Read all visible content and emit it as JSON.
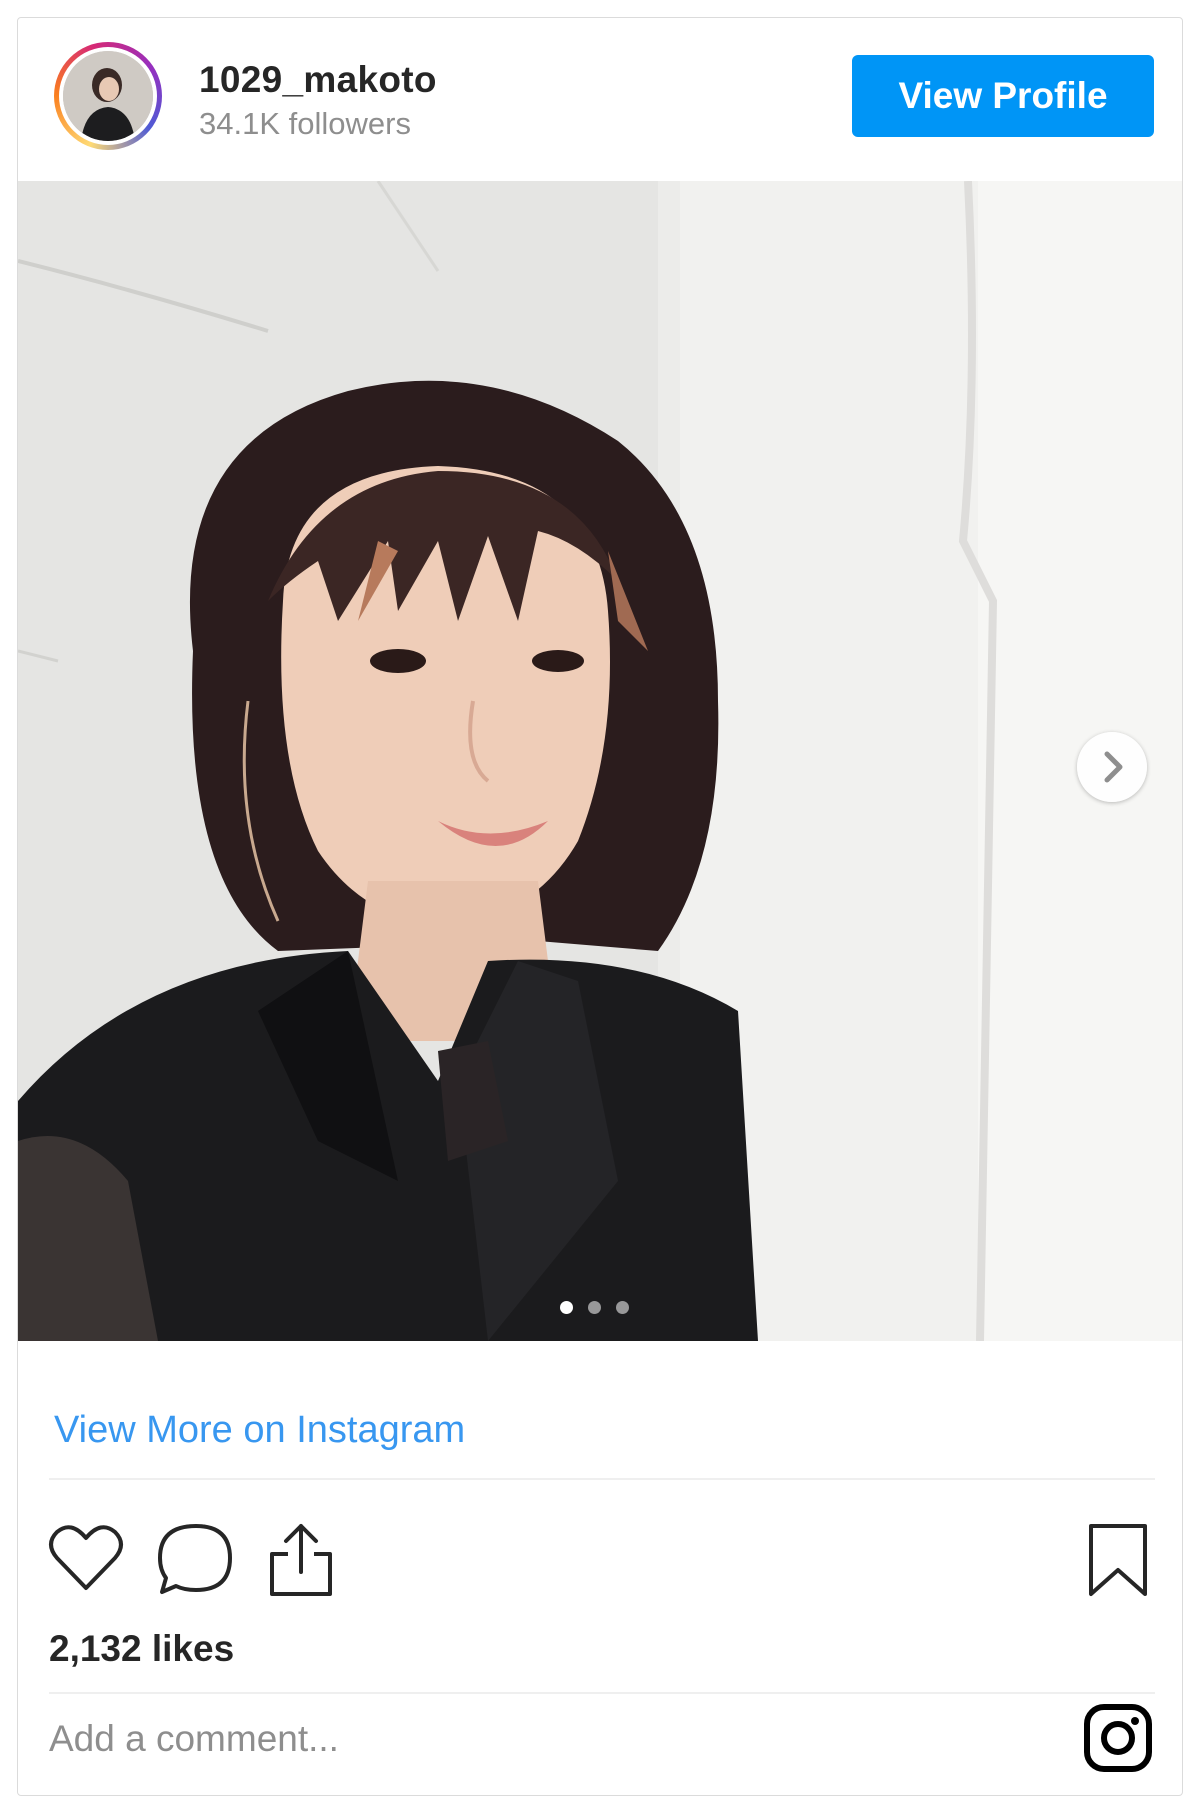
{
  "header": {
    "username": "1029_makoto",
    "followers": "34.1K followers",
    "view_profile_label": "View Profile"
  },
  "carousel": {
    "slide_count": 3,
    "active_slide": 1,
    "next_icon": "chevron-right-icon"
  },
  "view_more_label": "View More on Instagram",
  "actions": {
    "like_icon": "heart-icon",
    "comment_icon": "comment-icon",
    "share_icon": "share-icon",
    "save_icon": "bookmark-icon"
  },
  "likes": "2,132 likes",
  "comment": {
    "placeholder": "Add a comment..."
  },
  "brand": {
    "icon": "instagram-icon",
    "accent": "#0095f6",
    "link_color": "#3897f0"
  }
}
